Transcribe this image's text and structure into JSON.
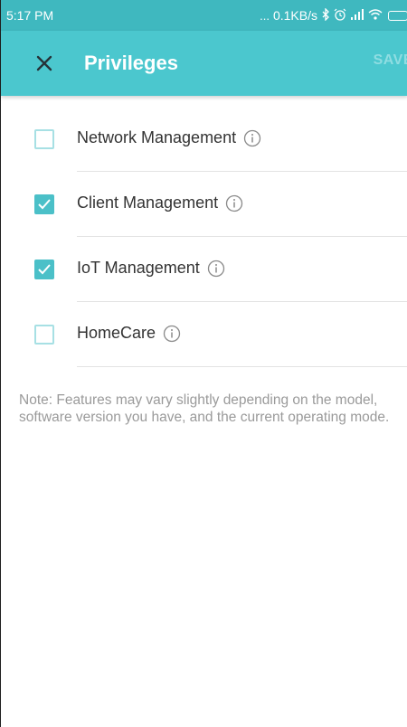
{
  "status_bar": {
    "time": "5:17 PM",
    "dots": "...",
    "network_speed": "0.1KB/s",
    "icons": [
      "bluetooth-icon",
      "alarm-icon",
      "signal-icon",
      "wifi-icon",
      "battery-icon"
    ]
  },
  "app_bar": {
    "close_icon": "close-icon",
    "title": "Privileges",
    "save_label": "SAVE",
    "background_color": "#4bc7ce"
  },
  "privileges": [
    {
      "label": "Network Management",
      "checked": false
    },
    {
      "label": "Client Management",
      "checked": true
    },
    {
      "label": "IoT Management",
      "checked": true
    },
    {
      "label": "HomeCare",
      "checked": false
    }
  ],
  "note": "Note: Features may vary slightly depending on the model, software version you have, and the current operating mode.",
  "colors": {
    "accent": "#4bc0c8",
    "checkbox_unchecked_border": "#a7e0e4",
    "text": "#333333",
    "note_text": "#9a9a9a"
  }
}
